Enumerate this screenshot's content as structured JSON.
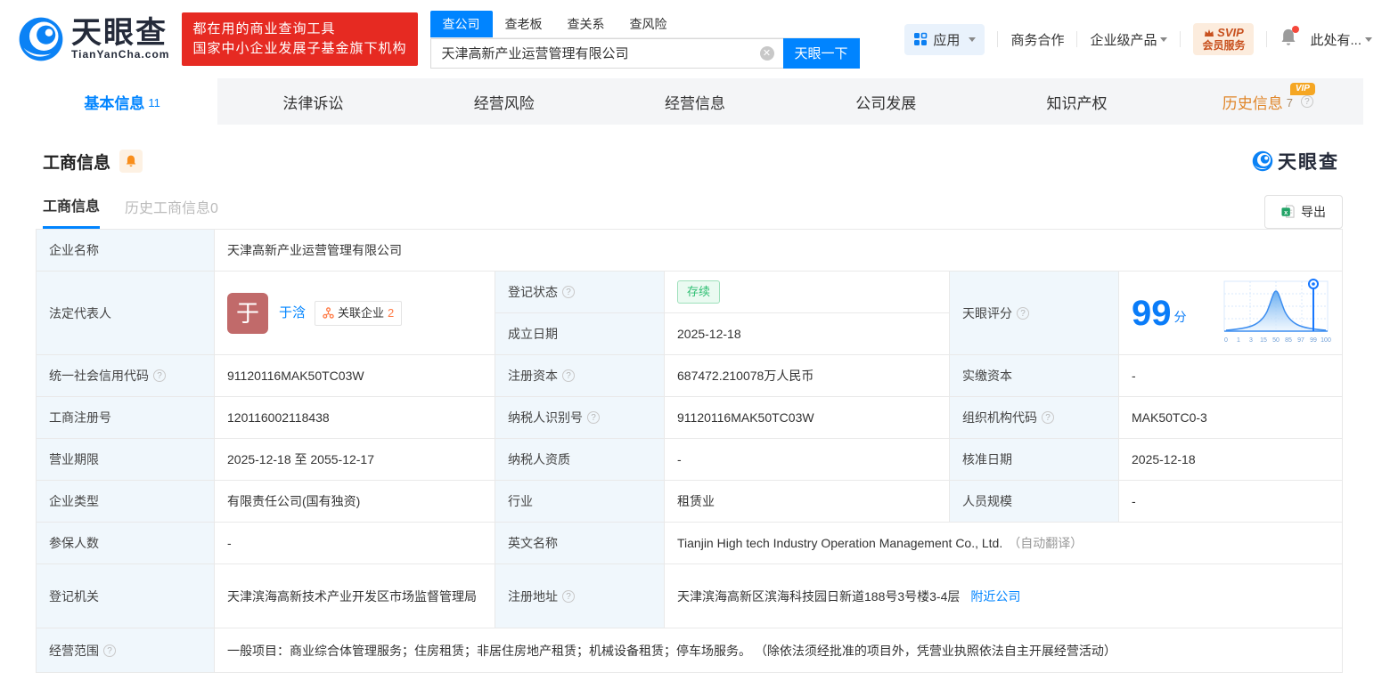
{
  "colors": {
    "accent": "#0084ff",
    "banner_red": "#e62a22",
    "vip_orange": "#f5a623",
    "status_green": "#2fbf73"
  },
  "header": {
    "logo": {
      "brand": "天眼查",
      "domain": "TianYanCha.com"
    },
    "banner": {
      "line1": "都在用的商业查询工具",
      "line2": "国家中小企业发展子基金旗下机构"
    },
    "search": {
      "tabs": [
        {
          "label": "查公司"
        },
        {
          "label": "查老板"
        },
        {
          "label": "查关系"
        },
        {
          "label": "查风险"
        }
      ],
      "value": "天津高新产业运营管理有限公司",
      "button": "天眼一下"
    },
    "right": {
      "apps": "应用",
      "business_coop": "商务合作",
      "enterprise": "企业级产品",
      "svip_line1": "SVIP",
      "svip_line2": "会员服务",
      "user_menu": "此处有..."
    }
  },
  "nav_tabs": [
    {
      "label": "基本信息",
      "count": "11"
    },
    {
      "label": "法律诉讼"
    },
    {
      "label": "经营风险"
    },
    {
      "label": "经营信息"
    },
    {
      "label": "公司发展"
    },
    {
      "label": "知识产权"
    },
    {
      "label": "历史信息",
      "count": "7",
      "vip": "VIP"
    }
  ],
  "section": {
    "title": "工商信息",
    "watermark": "天眼查",
    "subtabs": [
      {
        "label": "工商信息"
      },
      {
        "label": "历史工商信息0"
      }
    ],
    "export_label": "导出"
  },
  "table": {
    "company_name": {
      "label": "企业名称",
      "value": "天津高新产业运营管理有限公司"
    },
    "legal_rep": {
      "label": "法定代表人",
      "avatar_char": "于",
      "name": "于浛",
      "related_label": "关联企业",
      "related_count": "2"
    },
    "reg_status": {
      "label": "登记状态",
      "value": "存续"
    },
    "est_date": {
      "label": "成立日期",
      "value": "2025-12-18"
    },
    "score": {
      "label": "天眼评分",
      "value": "99",
      "unit": "分"
    },
    "credit_code": {
      "label": "统一社会信用代码",
      "value": "91120116MAK50TC03W"
    },
    "reg_capital": {
      "label": "注册资本",
      "value": "687472.210078万人民币"
    },
    "paid_capital": {
      "label": "实缴资本",
      "value": "-"
    },
    "reg_number": {
      "label": "工商注册号",
      "value": "120116002118438"
    },
    "taxpayer_id": {
      "label": "纳税人识别号",
      "value": "91120116MAK50TC03W"
    },
    "org_code": {
      "label": "组织机构代码",
      "value": "MAK50TC0-3"
    },
    "business_term": {
      "label": "营业期限",
      "value": "2025-12-18 至 2055-12-17"
    },
    "taxpayer_quality": {
      "label": "纳税人资质",
      "value": "-"
    },
    "approval_date": {
      "label": "核准日期",
      "value": "2025-12-18"
    },
    "company_type": {
      "label": "企业类型",
      "value": "有限责任公司(国有独资)"
    },
    "industry": {
      "label": "行业",
      "value": "租赁业"
    },
    "staff_size": {
      "label": "人员规模",
      "value": "-"
    },
    "insured_count": {
      "label": "参保人数",
      "value": "-"
    },
    "english_name": {
      "label": "英文名称",
      "value": "Tianjin High tech Industry Operation Management Co., Ltd.",
      "note": "（自动翻译）"
    },
    "reg_authority": {
      "label": "登记机关",
      "value": "天津滨海高新技术产业开发区市场监督管理局"
    },
    "reg_address": {
      "label": "注册地址",
      "value": "天津滨海高新区滨海科技园日新道188号3号楼3-4层",
      "link": "附近公司"
    },
    "business_scope": {
      "label": "经营范围",
      "value": "一般项目：商业综合体管理服务；住房租赁；非居住房地产租赁；机械设备租赁；停车场服务。 （除依法须经批准的项目外，凭营业执照依法自主开展经营活动）"
    }
  },
  "score_chart": {
    "type": "area",
    "description": "score distribution bell curve with marker at company score",
    "ticks": [
      "0",
      "1",
      "3",
      "15",
      "50",
      "85",
      "97",
      "99",
      "100"
    ],
    "marker_value": 99
  }
}
